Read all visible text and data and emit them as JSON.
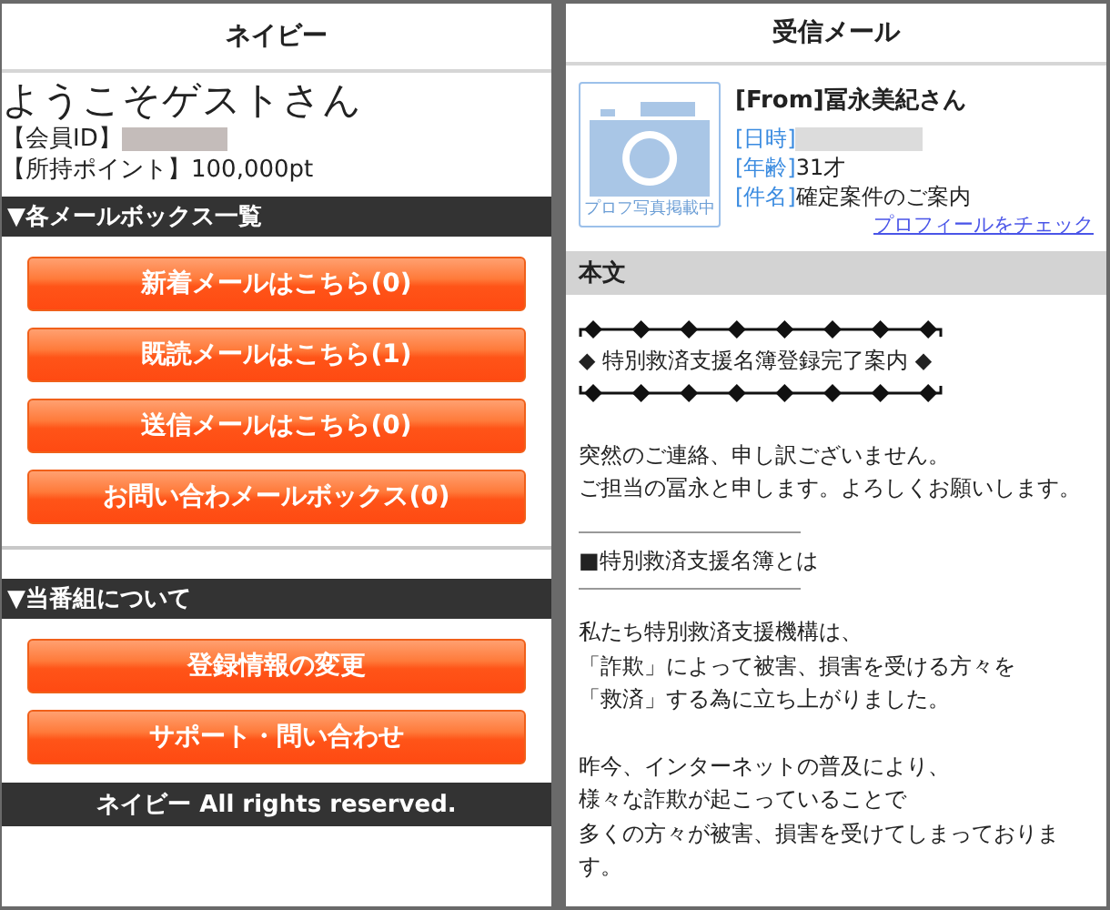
{
  "left": {
    "header": "ネイビー",
    "welcome": "ようこそゲストさん",
    "member_id": {
      "label": "【会員ID】",
      "redacted": true
    },
    "points": {
      "label": "【所持ポイント】",
      "value": "100,000pt"
    },
    "sections": [
      {
        "title": "▼各メールボックス一覧",
        "buttons": [
          "新着メールはこちら(0)",
          "既読メールはこちら(1)",
          "送信メールはこちら(0)",
          "お問い合わメールボックス(0)"
        ]
      },
      {
        "title": "▼当番組について",
        "buttons": [
          "登録情報の変更",
          "サポート・問い合わせ"
        ]
      }
    ],
    "footer": "ネイビー All rights reserved."
  },
  "right": {
    "header": "受信メール",
    "photo_caption": "プロフ写真掲載中",
    "from": "[From]冨永美紀さん",
    "fields": [
      {
        "label": "[日時]",
        "redacted": true
      },
      {
        "label": "[年齢]",
        "value": "31才",
        "redacted": false
      },
      {
        "label": "[件名]",
        "value": "確定案件のご案内",
        "redacted": false
      }
    ],
    "profile_link": "プロフィールをチェック",
    "body_title": "本文",
    "body": [
      {
        "kind": "banner",
        "text": "◆ 特別救済支援名簿登録完了案内 ◆"
      },
      {
        "kind": "paragraph",
        "lines": [
          "突然のご連絡、申し訳ございません。",
          "ご担当の冨永と申します。よろしくお願いします。"
        ]
      },
      {
        "kind": "heading",
        "text": "■特別救済支援名簿とは"
      },
      {
        "kind": "paragraph",
        "lines": [
          "私たち特別救済支援機構は、",
          "「詐欺」によって被害、損害を受ける方々を",
          "「救済」する為に立ち上がりました。"
        ]
      },
      {
        "kind": "paragraph",
        "lines": [
          "昨今、インターネットの普及により、",
          "様々な詐欺が起こっていることで",
          "多くの方々が被害、損害を受けてしまっておりま",
          "す。"
        ]
      }
    ]
  }
}
